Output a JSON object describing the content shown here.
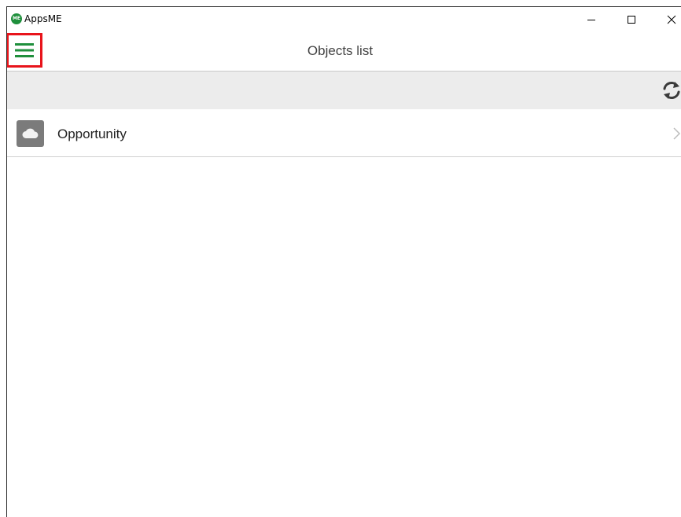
{
  "window": {
    "app_title": "AppsME",
    "logo_text": "ME",
    "accent_color": "#1f8f3c"
  },
  "header": {
    "title": "Objects list",
    "menu_icon": "hamburger-menu-icon",
    "highlight_color": "#e8141b"
  },
  "toolbar": {
    "refresh_icon": "refresh-icon"
  },
  "list": {
    "items": [
      {
        "label": "Opportunity",
        "icon": "cloud-icon"
      }
    ]
  }
}
